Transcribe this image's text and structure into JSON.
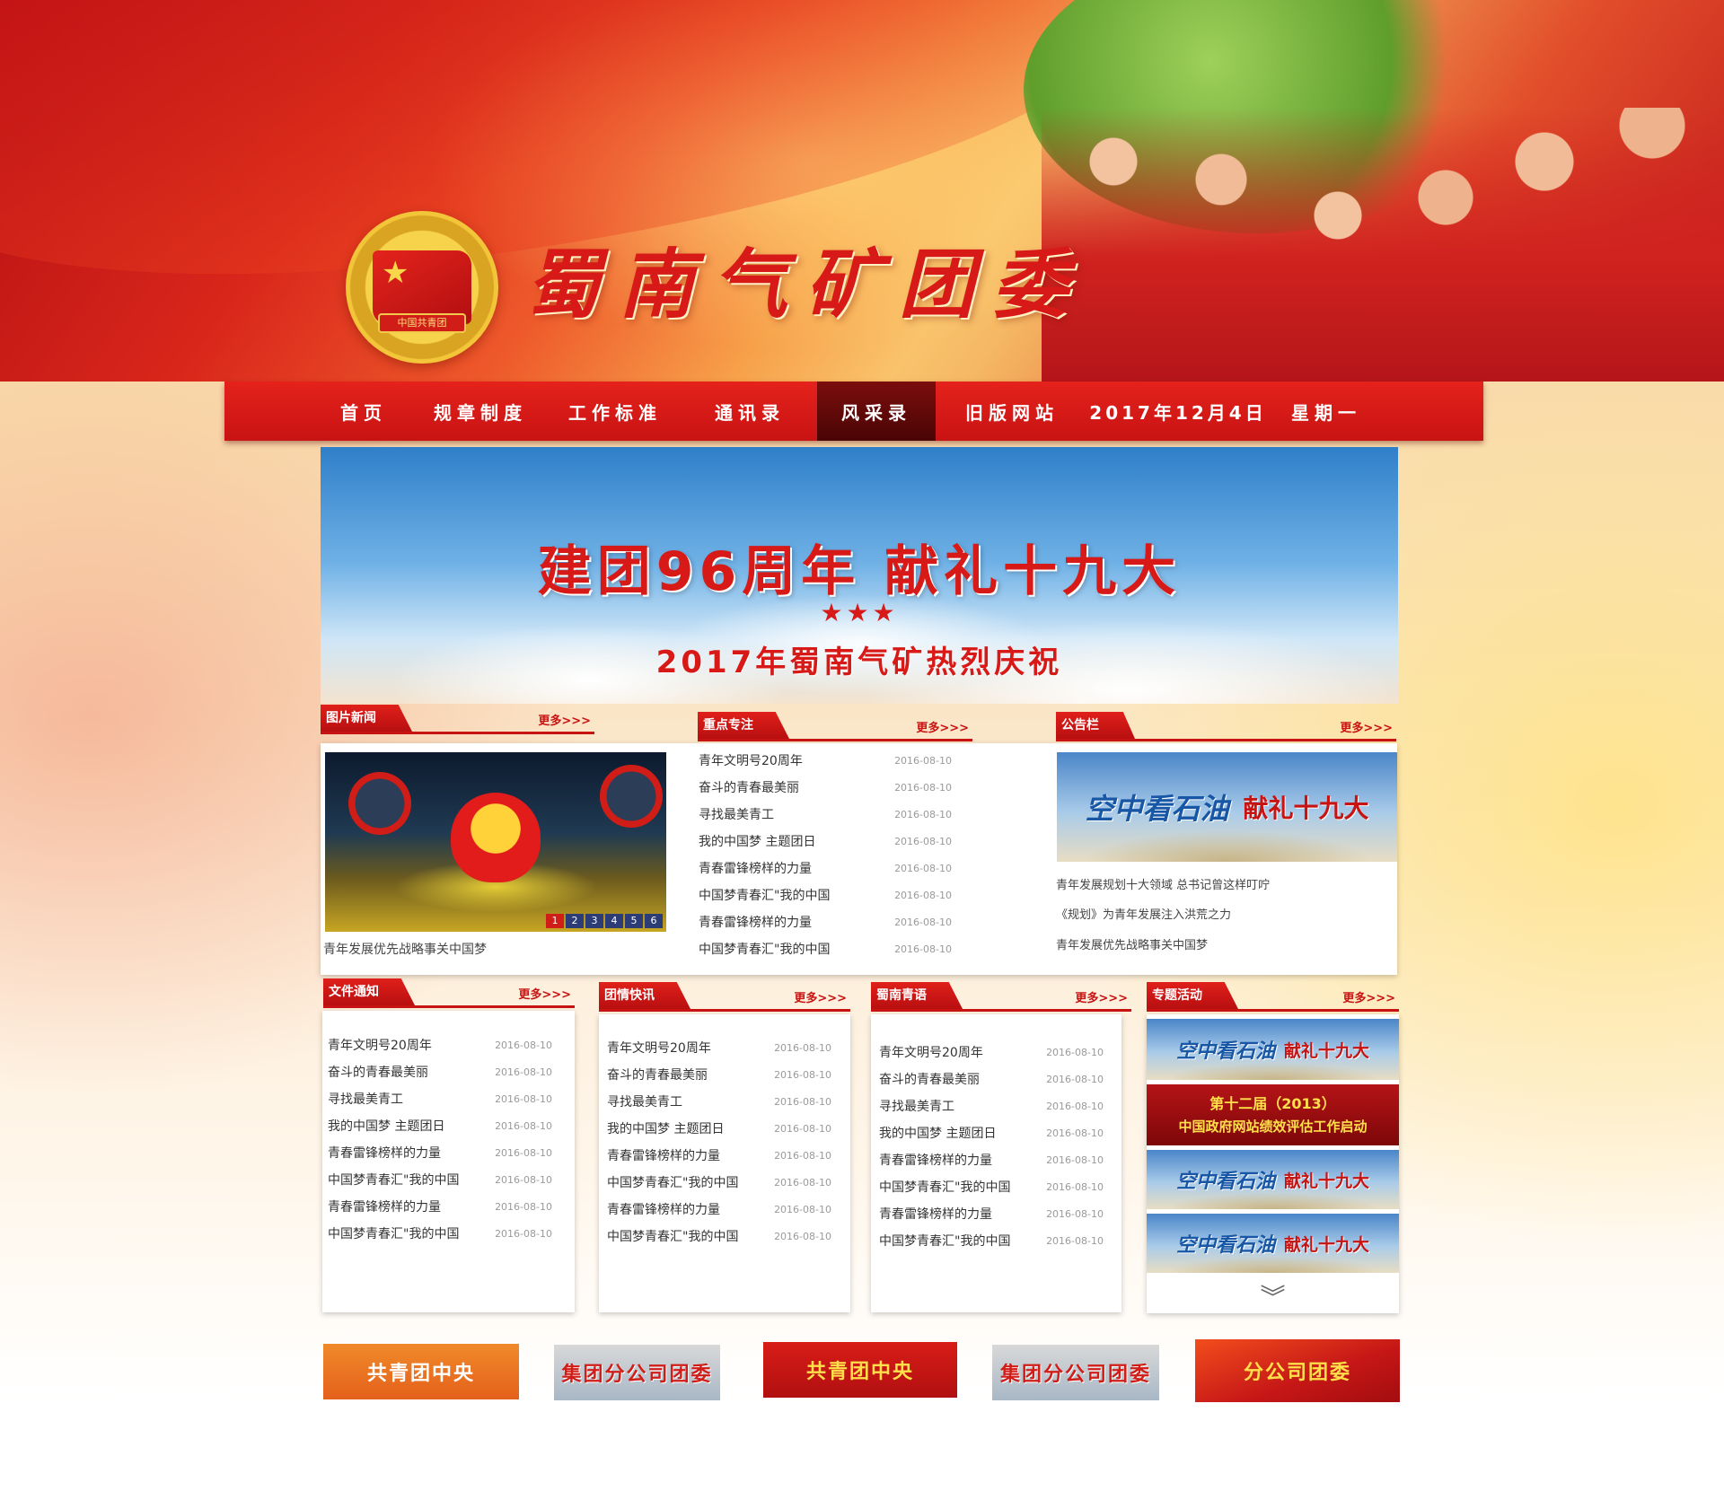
{
  "header": {
    "site_title": "蜀南气矿团委",
    "emblem_text": "中国共青团"
  },
  "nav": {
    "items": [
      {
        "label": "首页"
      },
      {
        "label": "规章制度"
      },
      {
        "label": "工作标准"
      },
      {
        "label": "通讯录"
      },
      {
        "label": "风采录",
        "active": true
      },
      {
        "label": "旧版网站"
      },
      {
        "label": "2017年12月4日"
      },
      {
        "label": "星期一"
      }
    ]
  },
  "banner": {
    "main_text": "建团96周年 献礼十九大",
    "stars": "★★★",
    "sub_text": "2017年蜀南气矿热烈庆祝"
  },
  "picture_news": {
    "title": "图片新闻",
    "more": "更多>>>",
    "pager": [
      "1",
      "2",
      "3",
      "4",
      "5",
      "6"
    ],
    "caption": "青年发展优先战略事关中国梦"
  },
  "focus": {
    "title": "重点专注",
    "more": "更多>>>",
    "items": [
      {
        "title": "青年文明号20周年",
        "date": "2016-08-10"
      },
      {
        "title": "奋斗的青春最美丽",
        "date": "2016-08-10"
      },
      {
        "title": "寻找最美青工",
        "date": "2016-08-10"
      },
      {
        "title": "我的中国梦 主题团日",
        "date": "2016-08-10"
      },
      {
        "title": "青春雷锋榜样的力量",
        "date": "2016-08-10"
      },
      {
        "title": "中国梦青春汇\"我的中国",
        "date": "2016-08-10"
      },
      {
        "title": "青春雷锋榜样的力量",
        "date": "2016-08-10"
      },
      {
        "title": "中国梦青春汇\"我的中国",
        "date": "2016-08-10"
      }
    ]
  },
  "notice": {
    "title": "公告栏",
    "more": "更多>>>",
    "image_text_1": "空中看石油",
    "image_text_2": "献礼十九大",
    "items": [
      "青年发展规划十大领域 总书记曾这样叮咛",
      "《规划》为青年发展注入洪荒之力",
      "青年发展优先战略事关中国梦"
    ]
  },
  "file_notice": {
    "title": "文件通知",
    "more": "更多>>>",
    "items": [
      {
        "title": "青年文明号20周年",
        "date": "2016-08-10"
      },
      {
        "title": "奋斗的青春最美丽",
        "date": "2016-08-10"
      },
      {
        "title": "寻找最美青工",
        "date": "2016-08-10"
      },
      {
        "title": "我的中国梦 主题团日",
        "date": "2016-08-10"
      },
      {
        "title": "青春雷锋榜样的力量",
        "date": "2016-08-10"
      },
      {
        "title": "中国梦青春汇\"我的中国",
        "date": "2016-08-10"
      },
      {
        "title": "青春雷锋榜样的力量",
        "date": "2016-08-10"
      },
      {
        "title": "中国梦青春汇\"我的中国",
        "date": "2016-08-10"
      }
    ]
  },
  "league_news": {
    "title": "团情快讯",
    "more": "更多>>>",
    "items": [
      {
        "title": "青年文明号20周年",
        "date": "2016-08-10"
      },
      {
        "title": "奋斗的青春最美丽",
        "date": "2016-08-10"
      },
      {
        "title": "寻找最美青工",
        "date": "2016-08-10"
      },
      {
        "title": "我的中国梦 主题团日",
        "date": "2016-08-10"
      },
      {
        "title": "青春雷锋榜样的力量",
        "date": "2016-08-10"
      },
      {
        "title": "中国梦青春汇\"我的中国",
        "date": "2016-08-10"
      },
      {
        "title": "青春雷锋榜样的力量",
        "date": "2016-08-10"
      },
      {
        "title": "中国梦青春汇\"我的中国",
        "date": "2016-08-10"
      }
    ]
  },
  "shunan_youth": {
    "title": "蜀南青语",
    "more": "更多>>>",
    "items": [
      {
        "title": "青年文明号20周年",
        "date": "2016-08-10"
      },
      {
        "title": "奋斗的青春最美丽",
        "date": "2016-08-10"
      },
      {
        "title": "寻找最美青工",
        "date": "2016-08-10"
      },
      {
        "title": "我的中国梦 主题团日",
        "date": "2016-08-10"
      },
      {
        "title": "青春雷锋榜样的力量",
        "date": "2016-08-10"
      },
      {
        "title": "中国梦青春汇\"我的中国",
        "date": "2016-08-10"
      },
      {
        "title": "青春雷锋榜样的力量",
        "date": "2016-08-10"
      },
      {
        "title": "中国梦青春汇\"我的中国",
        "date": "2016-08-10"
      }
    ]
  },
  "special": {
    "title": "专题活动",
    "more": "更多>>>",
    "banner_text_1": "空中看石油",
    "banner_text_2": "献礼十九大",
    "red_ad_line1": "第十二届（2013）",
    "red_ad_line2": "中国政府网站绩效评估工作启动",
    "scroll_down": "︾"
  },
  "bottom_links": [
    "共青团中央",
    "集团分公司团委",
    "共青团中央",
    "集团分公司团委",
    "分公司团委"
  ]
}
